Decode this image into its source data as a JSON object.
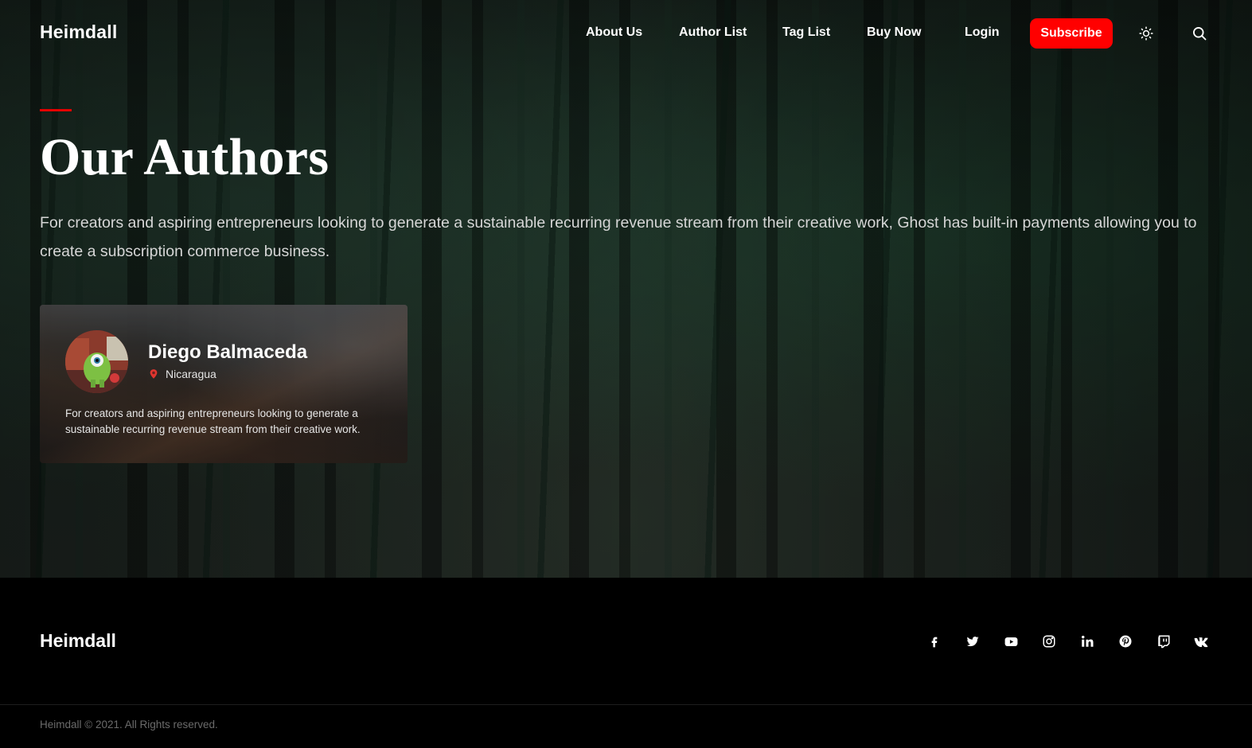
{
  "header": {
    "brand": "Heimdall",
    "nav": [
      {
        "label": "About Us"
      },
      {
        "label": "Author List"
      },
      {
        "label": "Tag List"
      },
      {
        "label": "Buy Now"
      },
      {
        "label": "Login"
      }
    ],
    "subscribe_label": "Subscribe",
    "theme_toggle_icon": "sun-icon",
    "search_icon": "search-icon"
  },
  "hero": {
    "title": "Our Authors",
    "description": "For creators and aspiring entrepreneurs looking to generate a sustainable recurring revenue stream from their creative work, Ghost has built-in payments allowing you to create a subscription commerce business."
  },
  "authors": [
    {
      "name": "Diego Balmaceda",
      "location": "Nicaragua",
      "location_icon": "map-pin-icon",
      "bio": "For creators and aspiring entrepreneurs looking to generate a sustainable recurring revenue stream from their creative work."
    }
  ],
  "footer": {
    "brand": "Heimdall",
    "social": [
      "facebook-icon",
      "twitter-icon",
      "youtube-icon",
      "instagram-icon",
      "linkedin-icon",
      "pinterest-icon",
      "twitch-icon",
      "vk-icon"
    ],
    "copyright": "Heimdall © 2021. All Rights reserved."
  },
  "colors": {
    "accent": "#ff0000",
    "background": "#000000",
    "text": "#ffffff"
  }
}
